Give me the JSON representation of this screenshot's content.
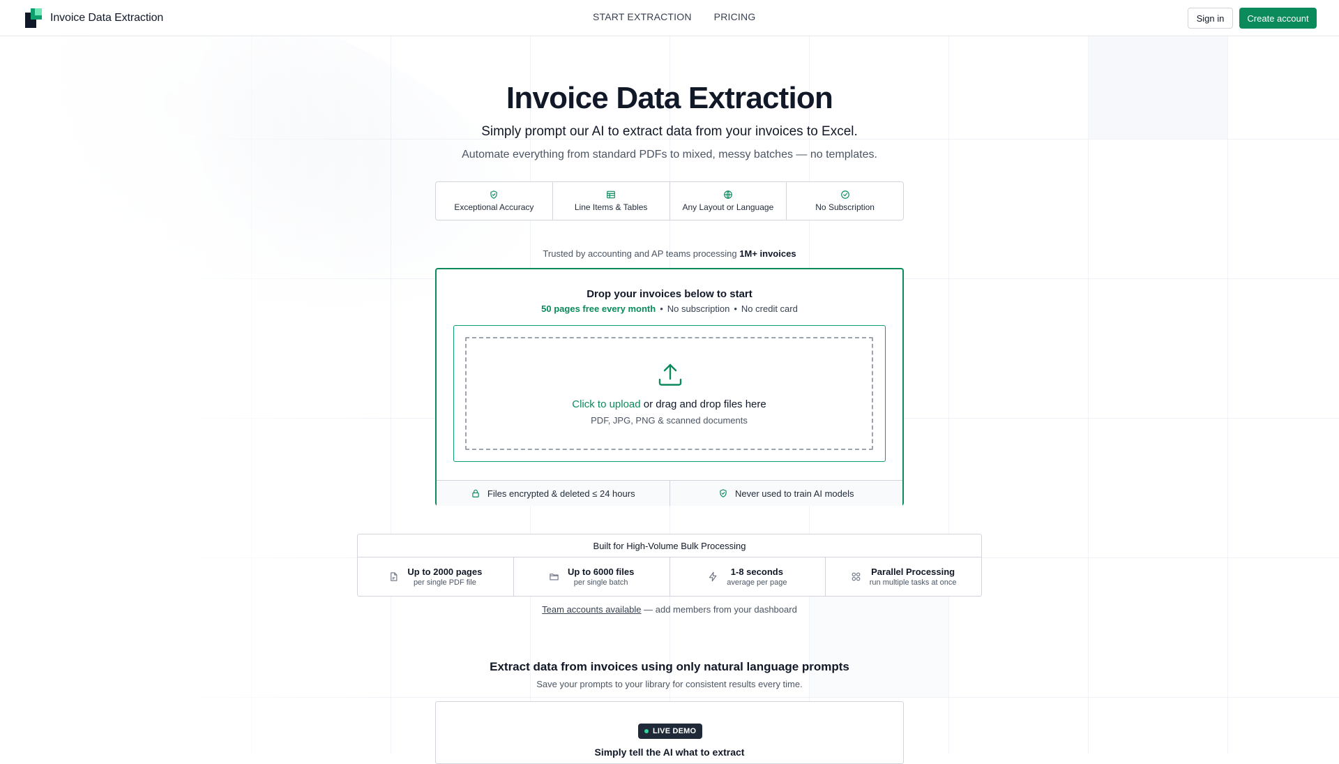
{
  "header": {
    "brand": "Invoice Data Extraction",
    "nav": [
      "START EXTRACTION",
      "PRICING"
    ],
    "sign_in": "Sign in",
    "create_account": "Create account"
  },
  "hero": {
    "title": "Invoice Data Extraction",
    "subtitle": "Simply prompt our AI to extract data from your invoices to Excel.",
    "tagline": "Automate everything from standard PDFs to mixed, messy batches — no templates."
  },
  "features": [
    {
      "label": "Exceptional Accuracy",
      "icon": "shield-check-icon"
    },
    {
      "label": "Line Items & Tables",
      "icon": "table-icon"
    },
    {
      "label": "Any Layout or Language",
      "icon": "globe-icon"
    },
    {
      "label": "No Subscription",
      "icon": "check-circle-icon"
    }
  ],
  "trusted": {
    "prefix": "Trusted by accounting and AP teams processing ",
    "highlight": "1M+ invoices"
  },
  "upload": {
    "title": "Drop your invoices below to start",
    "free": "50 pages free every month",
    "sep": "•",
    "no_sub": "No subscription",
    "no_card": "No credit card",
    "click_text": "Click to upload",
    "drag_text": " or drag and drop files here",
    "formats": "PDF, JPG, PNG & scanned documents",
    "security": [
      {
        "label": "Files encrypted & deleted ≤ 24 hours",
        "icon": "lock-icon"
      },
      {
        "label": "Never used to train AI models",
        "icon": "shield-check-icon"
      }
    ]
  },
  "bulk": {
    "title": "Built for High-Volume Bulk Processing",
    "items": [
      {
        "main": "Up to 2000 pages",
        "sub": "per single PDF file",
        "icon": "file-icon"
      },
      {
        "main": "Up to 6000 files",
        "sub": "per single batch",
        "icon": "folder-icon"
      },
      {
        "main": "1-8 seconds",
        "sub": "average per page",
        "icon": "lightning-icon"
      },
      {
        "main": "Parallel Processing",
        "sub": "run multiple tasks at once",
        "icon": "grid-icon"
      }
    ]
  },
  "team": {
    "link": "Team accounts available",
    "rest": " — add members from your dashboard"
  },
  "nl": {
    "title": "Extract data from invoices using only natural language prompts",
    "subtitle": "Save your prompts to your library for consistent results every time."
  },
  "demo": {
    "badge": "LIVE DEMO",
    "heading": "Simply tell the AI what to extract"
  },
  "colors": {
    "accent": "#0b8a5c",
    "text": "#111827",
    "muted": "#4b5563",
    "border": "#d1d5db"
  }
}
